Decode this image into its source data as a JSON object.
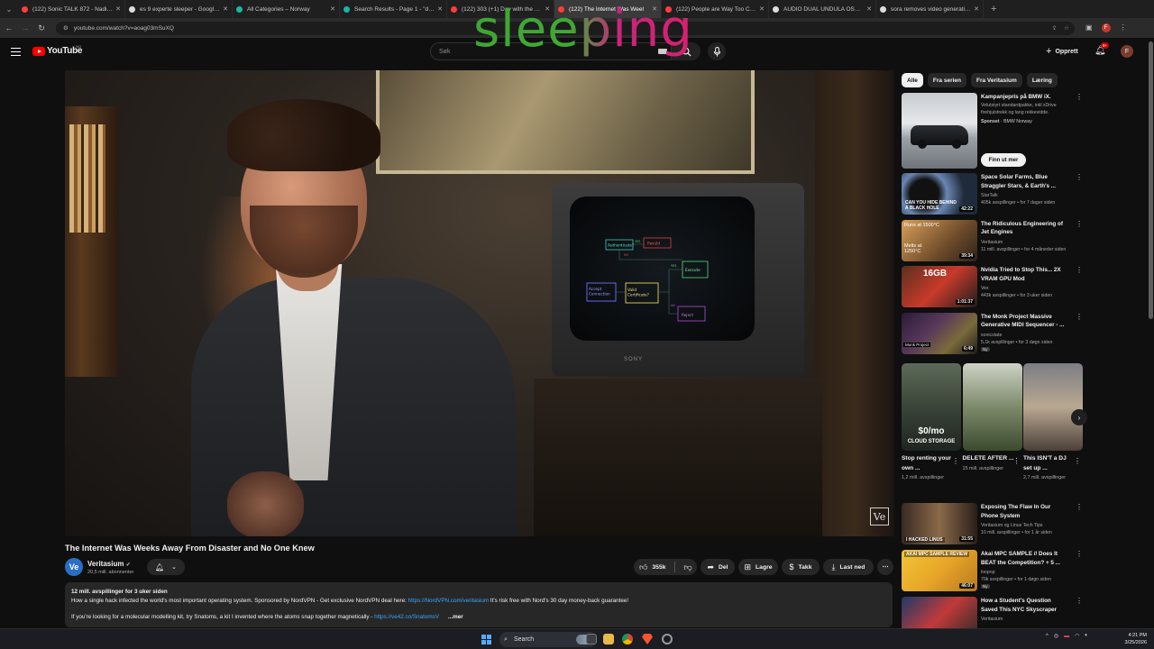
{
  "tabs": [
    {
      "title": "(122) Sonic TALK 872 - Nadia St",
      "color": "#ff3d3d"
    },
    {
      "title": "es 9 experte sleeper - Google S",
      "color": "#dddddd"
    },
    {
      "title": "All Categories – Norway",
      "color": "#1fb5a6"
    },
    {
      "title": "Search Results - Page 1 - \"dua",
      "color": "#1fb5a6"
    },
    {
      "title": "(122) 303 (+1) Day with the DU",
      "color": "#ff3d3d"
    },
    {
      "title": "(122) The Internet Was Weel",
      "color": "#ff3d3d",
      "active": true
    },
    {
      "title": "(122) People are Way Too Crun",
      "color": "#ff3d3d"
    },
    {
      "title": "AUDIO DUAL UNDULA OSCILL",
      "color": "#dddddd"
    },
    {
      "title": "sora removes video generating",
      "color": "#dddddd"
    }
  ],
  "browser": {
    "url": "youtube.com/watch?v=aoag03mSuXQ",
    "new_tab": "+"
  },
  "overlay_word": "sleeping",
  "header": {
    "logo": "YouTube",
    "region": "NO",
    "search_placeholder": "Søk",
    "create_label": "Opprett",
    "notification_count": "9+",
    "avatar_letter": "F"
  },
  "video": {
    "title": "The Internet Was Weeks Away From Disaster and No One Knew",
    "watermark": "Ve",
    "screen_nodes": [
      "Authenticate?",
      "Pwn2d",
      "Execute",
      "Accept Connection",
      "Valid Certificate?",
      "Reject"
    ],
    "screen_labels": [
      "YES",
      "NO",
      "YES",
      "NO"
    ],
    "tv_brand": "SONY"
  },
  "channel": {
    "initials": "Ve",
    "name": "Veritasium",
    "verified": "✔",
    "subscribers": "20,5 mill. abonnenter"
  },
  "actions": {
    "likes": "355k",
    "share": "Del",
    "save": "Lagre",
    "thanks": "Takk",
    "download": "Last ned"
  },
  "description": {
    "meta": "12 mill. avspillinger  for 3 uker siden",
    "line1_pre": "How a single hack infected the world's most important operating system. Sponsored by NordVPN - Get exclusive NordVPN deal here: ",
    "line1_link": "https://NordVPN.com/veritasium",
    "line1_post": " It's risk free with Nord's 30 day money-back guarantee!",
    "line2_pre": "If you're looking for a molecular modelling kit, try Snatoms, a kit I invented where the atoms snap together magnetically - ",
    "line2_link": "https://ve42.co/SnatomsV",
    "more": "...mer"
  },
  "chips": [
    "Alle",
    "Fra serien",
    "Fra Veritasium",
    "Læring"
  ],
  "ad": {
    "title": "Kampanjepris på BMW iX.",
    "body": "Velutstyrt standardpakke, inkl xDrive firehjulstrekk og lang rekkevidde.",
    "sponsor_label": "Sponset",
    "sponsor": " · BMW Norway",
    "cta": "Finn ut mer"
  },
  "recommendations": [
    {
      "title": "Space Solar Farms, Blue Straggler Stars, & Earth's ...",
      "channel": "StarTalk",
      "meta": "405k avspillinger • for 7 dager siden",
      "duration": "42:22"
    },
    {
      "title": "The Ridiculous Engineering of Jet Engines",
      "channel": "Veritasium",
      "meta": "11 mill. avspillinger • for 4 måneder siden",
      "duration": "39:34"
    },
    {
      "title": "Nvidia Tried to Stop This... 2X VRAM GPU Mod",
      "channel": "Vex",
      "meta": "443k avspillinger • for 3 uker siden",
      "duration": "1:01:37"
    },
    {
      "title": "The Monk Project Massive Generative MIDI Sequencer - ...",
      "channel": "sonicstate",
      "meta": "5,1k avspillinger • for 3 døgn siden",
      "duration": "6:49",
      "badge": "Ny"
    }
  ],
  "thumb_texts": {
    "blackhole": "CAN YOU HIDE BEHIND A BLACK HOLE",
    "jet1": "Runs at 1500°C",
    "jet2": "Melts at 1250°C",
    "gpu": "16GB",
    "monk": "Monk Project"
  },
  "shorts": [
    {
      "title": "Stop renting your own ...",
      "views": "1,2 mill. avspillinger",
      "overlay1": "$0/mo",
      "overlay2": "CLOUD STORAGE"
    },
    {
      "title": "DELETE AFTER ...",
      "views": "15 mill. avspillinger"
    },
    {
      "title": "This ISN'T a DJ set up ...",
      "views": "2,7 mill. avspillinger"
    }
  ],
  "recommendations2": [
    {
      "title": "Exposing The Flaw In Our Phone System",
      "channel": "Veritasium og Linus Tech Tips",
      "meta": "10 mill. avspillinger • for 1 år siden",
      "duration": "31:55",
      "overlay": "I HACKED LINUS"
    },
    {
      "title": "Akai MPC SAMPLE // Does It BEAT the Competition? + 5 ...",
      "channel": "loopop",
      "meta": "70k avspillinger • for 1 døgn siden",
      "duration": "46:07",
      "badge": "Ny",
      "overlay": "AKAI MPC SAMPLE  REVIEW"
    },
    {
      "title": "How a Student's Question Saved This NYC Skyscraper",
      "channel": "Veritasium",
      "meta": "",
      "duration": ""
    }
  ],
  "taskbar": {
    "search_label": "Search",
    "time": "4:21 PM",
    "date": "3/25/2026"
  }
}
